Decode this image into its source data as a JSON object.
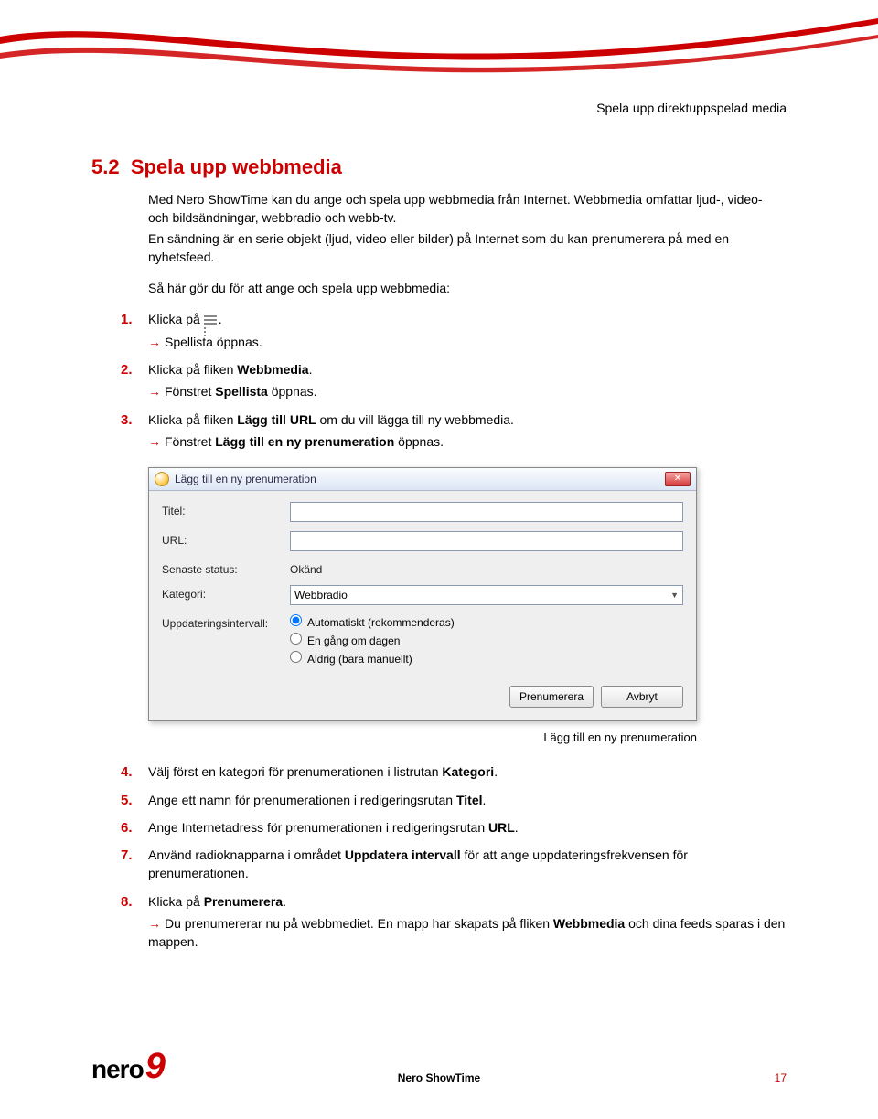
{
  "header": {
    "running_title": "Spela upp direktuppspelad media"
  },
  "section": {
    "number": "5.2",
    "title": "Spela upp webbmedia",
    "intro1": "Med Nero ShowTime kan du ange och spela upp webbmedia från Internet. Webbmedia omfattar ljud-, video- och bildsändningar, webbradio och webb-tv.",
    "intro2": "En sändning är en serie objekt (ljud, video eller bilder) på Internet som du kan prenumerera på med en nyhetsfeed.",
    "lead": "Så här gör du för att ange och spela upp webbmedia:"
  },
  "steps": {
    "s1": {
      "num": "1.",
      "text_a": "Klicka på ",
      "text_b": ".",
      "sub": "Spellista öppnas."
    },
    "s2": {
      "num": "2.",
      "text_a": "Klicka på fliken ",
      "bold": "Webbmedia",
      "text_b": ".",
      "sub_a": "Fönstret ",
      "sub_bold": "Spellista",
      "sub_b": " öppnas."
    },
    "s3": {
      "num": "3.",
      "text_a": "Klicka på fliken ",
      "bold": "Lägg till URL",
      "text_b": " om du vill lägga till ny webbmedia.",
      "sub_a": "Fönstret ",
      "sub_bold": "Lägg till en ny prenumeration",
      "sub_b": " öppnas."
    },
    "s4": {
      "num": "4.",
      "text_a": "Välj först en kategori för prenumerationen i listrutan ",
      "bold": "Kategori",
      "text_b": "."
    },
    "s5": {
      "num": "5.",
      "text_a": "Ange ett namn för prenumerationen i redigeringsrutan ",
      "bold": "Titel",
      "text_b": "."
    },
    "s6": {
      "num": "6.",
      "text_a": "Ange Internetadress för prenumerationen i redigeringsrutan ",
      "bold": "URL",
      "text_b": "."
    },
    "s7": {
      "num": "7.",
      "text_a": "Använd radioknapparna i området ",
      "bold": "Uppdatera intervall",
      "text_b": " för att ange uppdateringsfrekvensen för prenumerationen."
    },
    "s8": {
      "num": "8.",
      "text_a": "Klicka på ",
      "bold": "Prenumerera",
      "text_b": ".",
      "sub_a": "Du prenumererar nu på webbmediet. En mapp har skapats på fliken ",
      "sub_bold": "Webbmedia",
      "sub_b": " och dina feeds sparas i den mappen."
    }
  },
  "dialog": {
    "title": "Lägg till en ny prenumeration",
    "labels": {
      "titel": "Titel:",
      "url": "URL:",
      "status": "Senaste status:",
      "kategori": "Kategori:",
      "intervall": "Uppdateringsintervall:"
    },
    "status_value": "Okänd",
    "kategori_value": "Webbradio",
    "radios": {
      "r1": "Automatiskt (rekommenderas)",
      "r2": "En gång om dagen",
      "r3": "Aldrig (bara manuellt)"
    },
    "buttons": {
      "ok": "Prenumerera",
      "cancel": "Avbryt"
    },
    "close": "✕",
    "caption": "Lägg till en ny prenumeration"
  },
  "footer": {
    "product": "Nero ShowTime",
    "page": "17",
    "logo_text": "nero",
    "logo_nine": "9"
  }
}
